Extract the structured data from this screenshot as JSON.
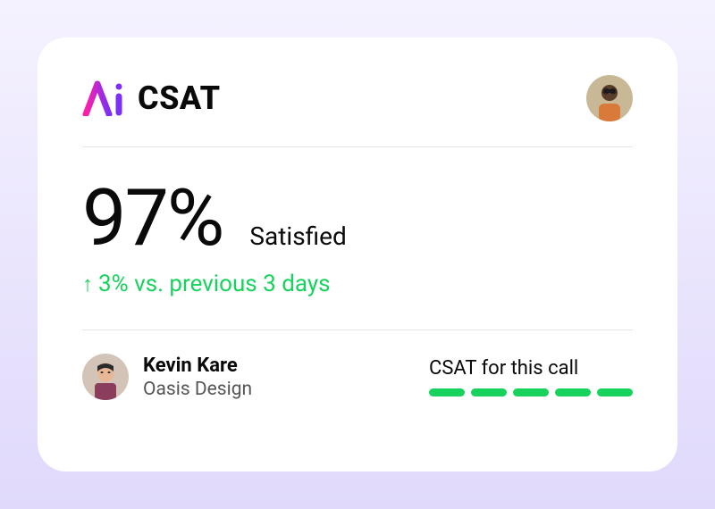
{
  "header": {
    "title": "CSAT"
  },
  "score": {
    "value": "97%",
    "label": "Satisfied",
    "delta_text": "3% vs. previous 3 days"
  },
  "caller": {
    "name": "Kevin Kare",
    "company": "Oasis Design"
  },
  "call_rating": {
    "label": "CSAT for this call",
    "bars": 5
  },
  "colors": {
    "positive": "#18d25e"
  }
}
